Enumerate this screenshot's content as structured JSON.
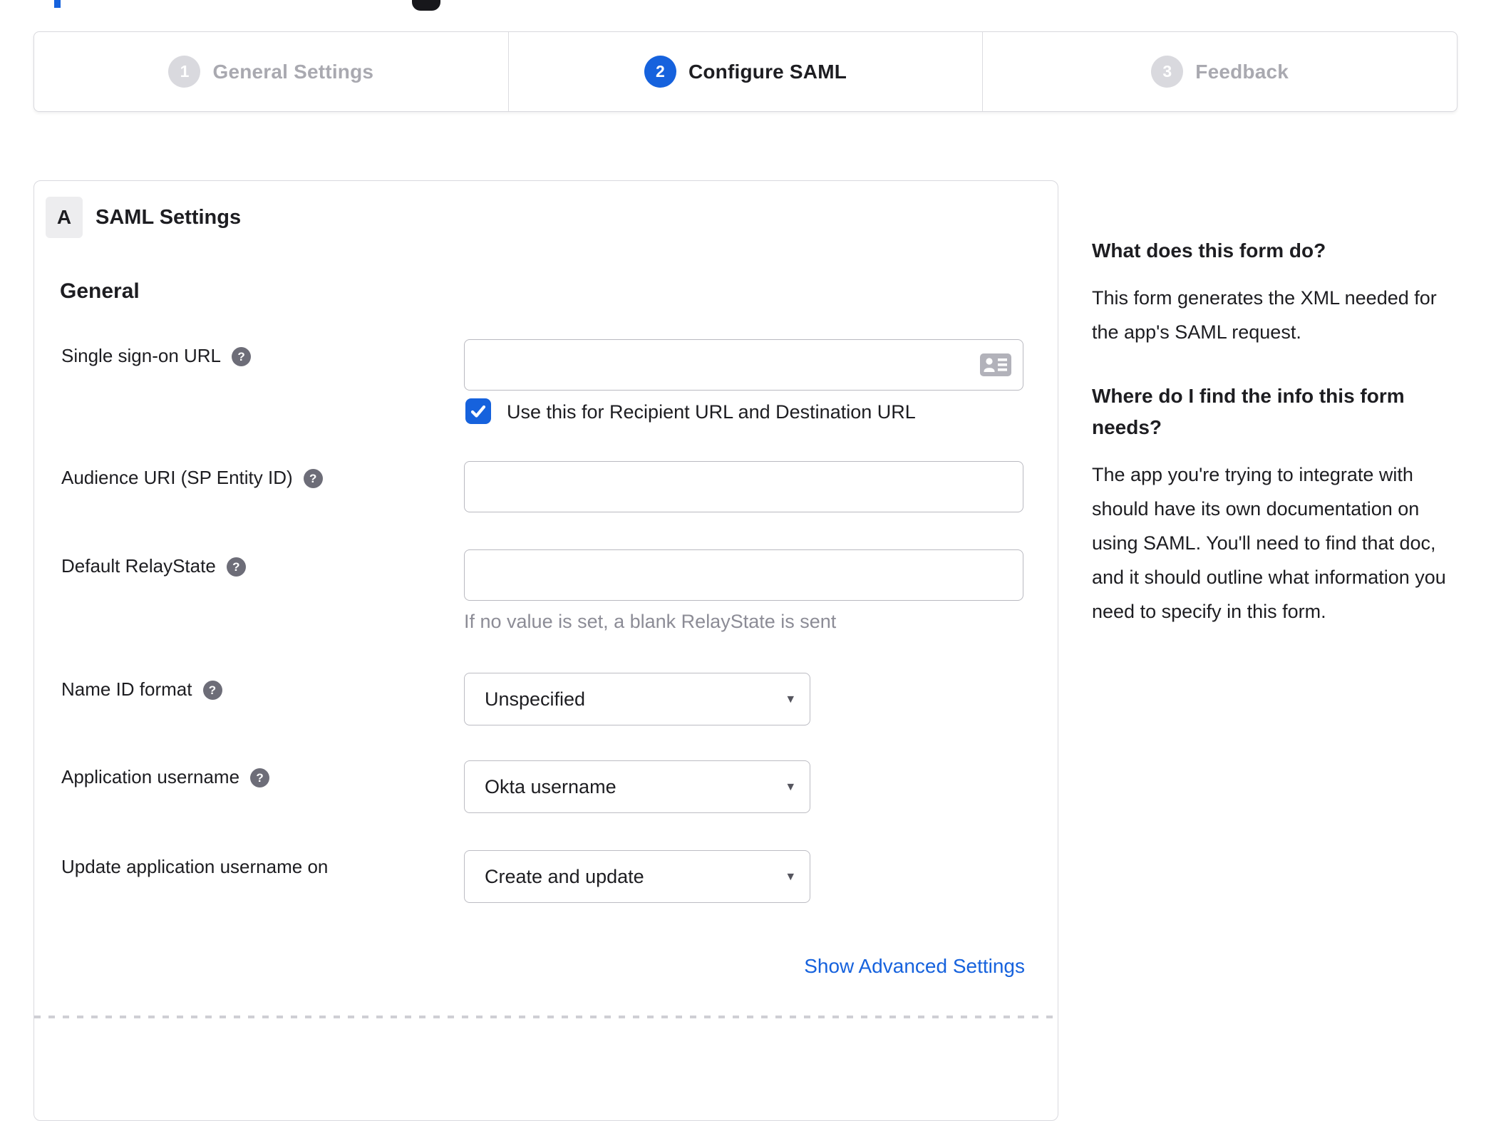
{
  "stepper": {
    "steps": [
      {
        "number": "1",
        "label": "General Settings",
        "state": "inactive"
      },
      {
        "number": "2",
        "label": "Configure SAML",
        "state": "active"
      },
      {
        "number": "3",
        "label": "Feedback",
        "state": "inactive"
      }
    ]
  },
  "panel": {
    "badge": "A",
    "title": "SAML Settings",
    "section_heading": "General",
    "fields": [
      {
        "label": "Single sign-on URL",
        "type": "text",
        "value": ""
      },
      {
        "label": "Audience URI (SP Entity ID)",
        "type": "text",
        "value": ""
      },
      {
        "label": "Default RelayState",
        "type": "text",
        "value": "",
        "helper": "If no value is set, a blank RelayState is sent"
      },
      {
        "label": "Name ID format",
        "type": "select",
        "value": "Unspecified"
      },
      {
        "label": "Application username",
        "type": "select",
        "value": "Okta username"
      },
      {
        "label": "Update application username on",
        "type": "select",
        "value": "Create and update"
      }
    ],
    "sso_checkbox": {
      "checked": true,
      "label": "Use this for Recipient URL and Destination URL"
    },
    "advanced_link": "Show Advanced Settings"
  },
  "sidebar": {
    "sections": [
      {
        "heading": "What does this form do?",
        "body": "This form generates the XML needed for the app's SAML request."
      },
      {
        "heading": "Where do I find the info this form needs?",
        "body": "The app you're trying to integrate with should have its own documentation on using SAML. You'll need to find that doc, and it should outline what information you need to specify in this form."
      }
    ]
  },
  "colors": {
    "accent_blue": "#1662dd",
    "inactive_grey": "#d9d9de",
    "text_dark": "#1d1d21",
    "muted_text": "#a9a9b0",
    "helper_grey": "#8c8c96"
  }
}
